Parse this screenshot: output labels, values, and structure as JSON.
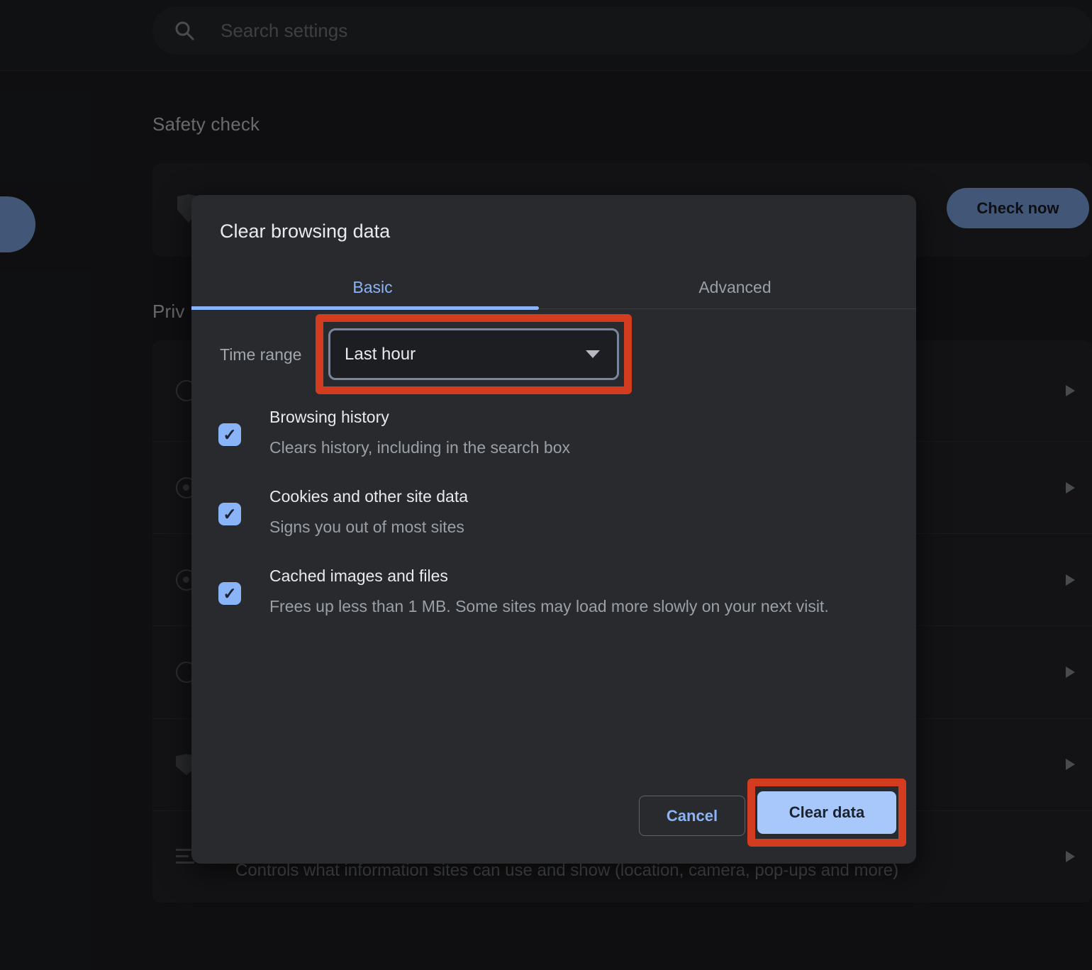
{
  "page": {
    "search": {
      "placeholder": "Search settings"
    },
    "safety_check": {
      "heading": "Safety check",
      "check_now_label": "Check now"
    },
    "privacy_heading_visible": "Priv",
    "site_settings_caption": "Controls what information sites can use and show (location, camera, pop-ups and more)",
    "privacy_row_count": 6
  },
  "dialog": {
    "title": "Clear browsing data",
    "tabs": [
      {
        "label": "Basic",
        "active": true
      },
      {
        "label": "Advanced",
        "active": false
      }
    ],
    "time_range": {
      "label": "Time range",
      "value": "Last hour"
    },
    "options": [
      {
        "label": "Browsing history",
        "description": "Clears history, including in the search box",
        "checked": true
      },
      {
        "label": "Cookies and other site data",
        "description": "Signs you out of most sites",
        "checked": true
      },
      {
        "label": "Cached images and files",
        "description": "Frees up less than 1 MB. Some sites may load more slowly on your next visit.",
        "checked": true
      }
    ],
    "buttons": {
      "cancel": "Cancel",
      "confirm": "Clear data"
    }
  },
  "icons": {
    "checkmark": "✓"
  },
  "colors": {
    "accent_blue": "#8ab4f8",
    "confirm_button_fill": "#a8c7fa",
    "annotation_red": "#d43c20",
    "dialog_bg": "#292a2d",
    "page_bg": "#202124",
    "text_primary": "#e8eaed",
    "text_secondary": "#9aa0a6"
  }
}
